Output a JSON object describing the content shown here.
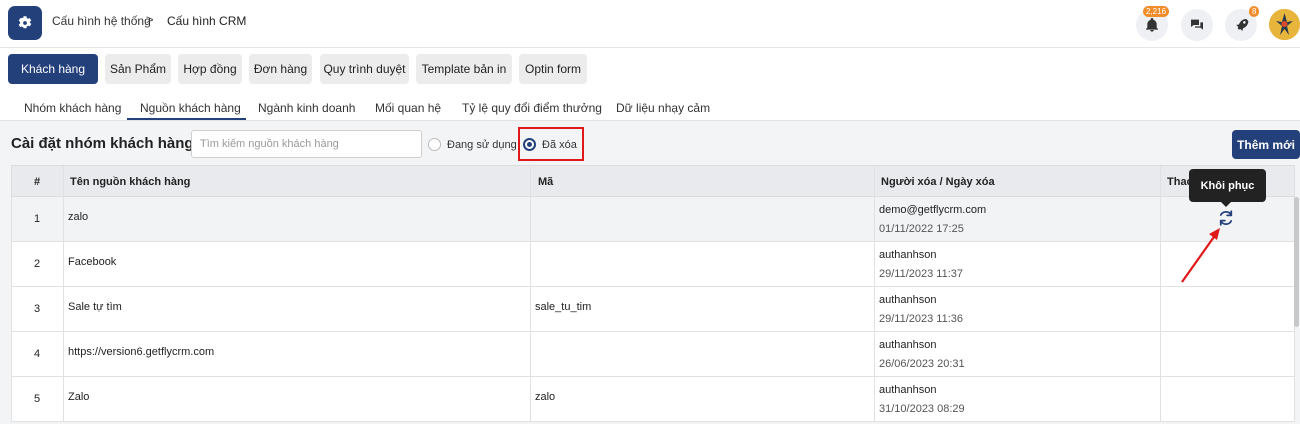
{
  "breadcrumb": {
    "parent": "Cấu hình hệ thống",
    "separator": ">",
    "current": "Cấu hình CRM"
  },
  "header": {
    "notification_count": "2,216",
    "rocket_count": "8"
  },
  "modules": [
    {
      "label": "Khách hàng",
      "active": true
    },
    {
      "label": "Sản Phẩm"
    },
    {
      "label": "Hợp đồng"
    },
    {
      "label": "Đơn hàng"
    },
    {
      "label": "Quy trình duyệt"
    },
    {
      "label": "Template bản in"
    },
    {
      "label": "Optin form"
    }
  ],
  "subtabs": [
    {
      "label": "Nhóm khách hàng"
    },
    {
      "label": "Nguồn khách hàng",
      "active": true
    },
    {
      "label": "Ngành kinh doanh"
    },
    {
      "label": "Mối quan hệ"
    },
    {
      "label": "Tỷ lệ quy đổi điểm thưởng"
    },
    {
      "label": "Dữ liệu nhạy cảm"
    }
  ],
  "toolbar": {
    "title": "Cài đặt nhóm khách hàng",
    "search_placeholder": "Tìm kiếm nguồn khách hàng",
    "radio_in_use": "Đang sử dụng",
    "radio_deleted": "Đã xóa",
    "selected_filter": "Đã xóa",
    "add_label": "Thêm mới"
  },
  "table": {
    "headers": [
      "#",
      "Tên nguồn khách hàng",
      "Mã",
      "Người xóa / Ngày xóa",
      "Thao tác"
    ],
    "rows": [
      {
        "num": "1",
        "name": "zalo",
        "code": "",
        "user": "demo@getflycrm.com",
        "date": "01/11/2022 17:25"
      },
      {
        "num": "2",
        "name": "Facebook",
        "code": "",
        "user": "authanhson",
        "date": "29/11/2023 11:37"
      },
      {
        "num": "3",
        "name": "Sale tự tìm",
        "code": "sale_tu_tim",
        "user": "authanhson",
        "date": "29/11/2023 11:36"
      },
      {
        "num": "4",
        "name": "https://version6.getflycrm.com",
        "code": "",
        "user": "authanhson",
        "date": "26/06/2023 20:31"
      },
      {
        "num": "5",
        "name": "Zalo",
        "code": "zalo",
        "user": "authanhson",
        "date": "31/10/2023 08:29"
      }
    ]
  },
  "tooltip": {
    "label": "Khôi phục"
  },
  "colors": {
    "primary": "#24407a",
    "highlight": "#e01818",
    "badge": "#f08c2a"
  }
}
